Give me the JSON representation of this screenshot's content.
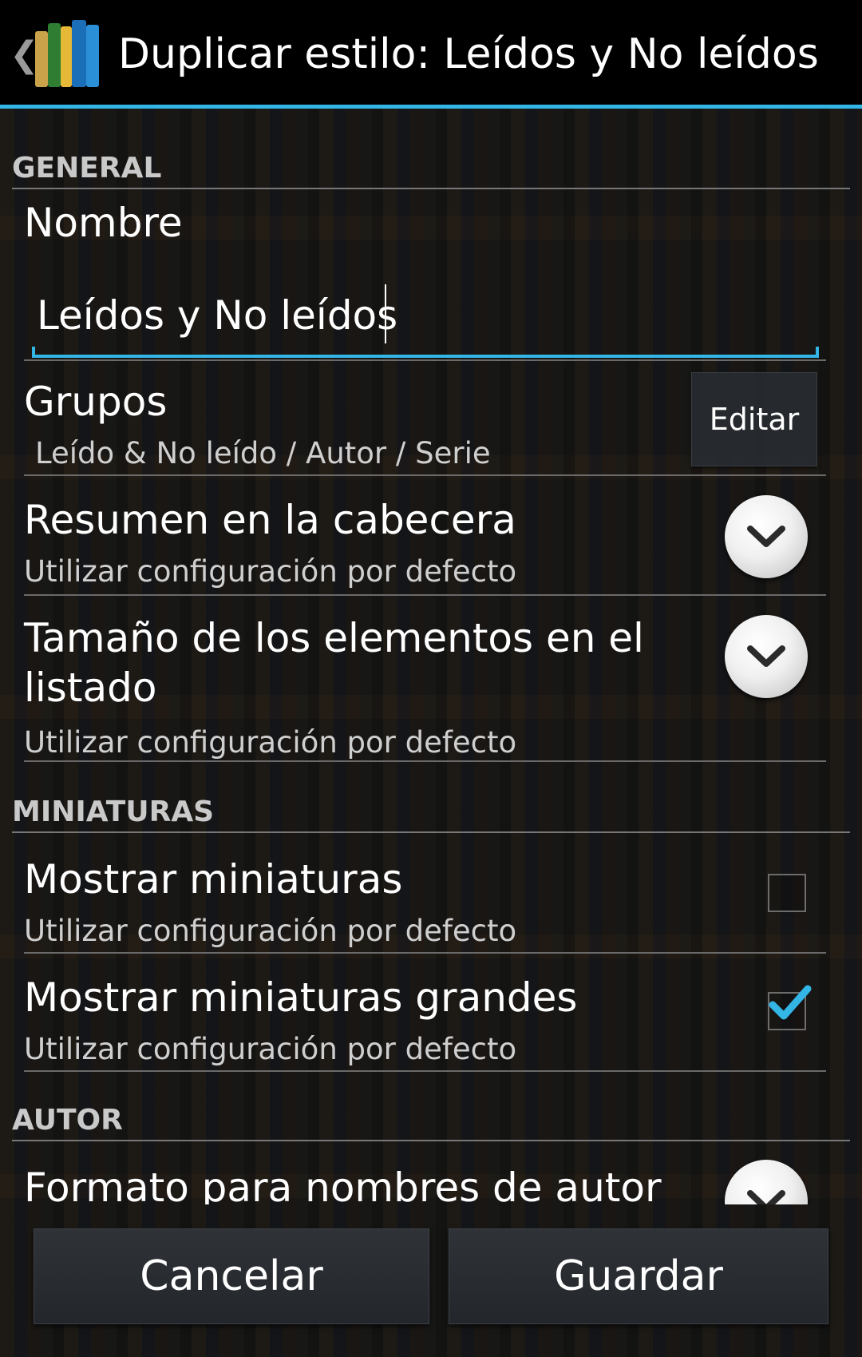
{
  "action_bar": {
    "title": "Duplicar estilo: Leídos y No leídos",
    "back_glyph": "❮",
    "accent_color": "#33b5e5"
  },
  "sections": {
    "general": "GENERAL",
    "miniaturas": "MINIATURAS",
    "autor": "AUTOR"
  },
  "nombre": {
    "title": "Nombre",
    "value": "Leídos y No leídos"
  },
  "grupos": {
    "title": "Grupos",
    "summary": "Leído & No leído / Autor / Serie",
    "edit_label": "Editar"
  },
  "resumen": {
    "title": "Resumen en la cabecera",
    "summary": "Utilizar configuración por defecto"
  },
  "tamano": {
    "title_line1": "Tamaño de los elementos en el",
    "title_line2": "listado",
    "summary": "Utilizar configuración por defecto"
  },
  "mostrar_miniaturas": {
    "title": "Mostrar miniaturas",
    "summary": "Utilizar configuración por defecto",
    "checked": false
  },
  "mostrar_miniaturas_grandes": {
    "title": "Mostrar miniaturas grandes",
    "summary": "Utilizar configuración por defecto",
    "checked": true
  },
  "formato_autor": {
    "title": "Formato para nombres de autor"
  },
  "buttons": {
    "cancel": "Cancelar",
    "save": "Guardar"
  }
}
